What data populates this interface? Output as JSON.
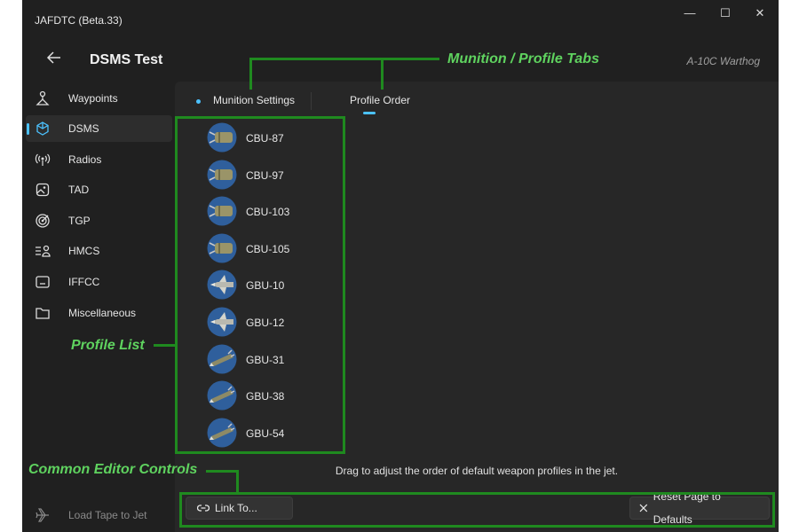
{
  "window": {
    "app_title": "JAFDTC (Beta.33)",
    "controls": {
      "minimize": "—",
      "maximize": "☐",
      "close": "✕"
    }
  },
  "header": {
    "back_icon": "back-arrow-icon",
    "title": "DSMS Test",
    "airframe": "A-10C Warthog"
  },
  "sidebar": {
    "items": [
      {
        "label": "Waypoints",
        "icon": "waypoint-icon",
        "active": false
      },
      {
        "label": "DSMS",
        "icon": "dsms-icon",
        "active": true
      },
      {
        "label": "Radios",
        "icon": "radio-icon",
        "active": false
      },
      {
        "label": "TAD",
        "icon": "tad-icon",
        "active": false
      },
      {
        "label": "TGP",
        "icon": "tgp-icon",
        "active": false
      },
      {
        "label": "HMCS",
        "icon": "hmcs-icon",
        "active": false
      },
      {
        "label": "IFFCC",
        "icon": "iffcc-icon",
        "active": false
      },
      {
        "label": "Miscellaneous",
        "icon": "folder-icon",
        "active": false
      }
    ],
    "load_tape": {
      "label": "Load Tape to Jet",
      "icon": "jet-icon"
    }
  },
  "tabs": [
    {
      "label": "Munition Settings",
      "selected": false,
      "modified": true
    },
    {
      "label": "Profile Order",
      "selected": true
    }
  ],
  "profiles": [
    {
      "label": "CBU-87",
      "kind": "cbu"
    },
    {
      "label": "CBU-97",
      "kind": "cbu"
    },
    {
      "label": "CBU-103",
      "kind": "cbu"
    },
    {
      "label": "CBU-105",
      "kind": "cbu"
    },
    {
      "label": "GBU-10",
      "kind": "gbu-pave"
    },
    {
      "label": "GBU-12",
      "kind": "gbu-pave"
    },
    {
      "label": "GBU-31",
      "kind": "jdam"
    },
    {
      "label": "GBU-38",
      "kind": "jdam"
    },
    {
      "label": "GBU-54",
      "kind": "jdam"
    }
  ],
  "hint": "Drag to adjust the order of default weapon profiles in the jet.",
  "footer": {
    "link_button": "Link To...",
    "link_icon": "link-icon",
    "reset_button": "Reset Page to Defaults",
    "reset_icon": "close-icon"
  },
  "annotations": {
    "tabs": "Munition / Profile Tabs",
    "list": "Profile List",
    "controls": "Common Editor Controls"
  },
  "colors": {
    "accent": "#4cc2ff",
    "annotation": "#1f8a1f",
    "annotation_text": "#5fd35f",
    "background": "#202020"
  }
}
